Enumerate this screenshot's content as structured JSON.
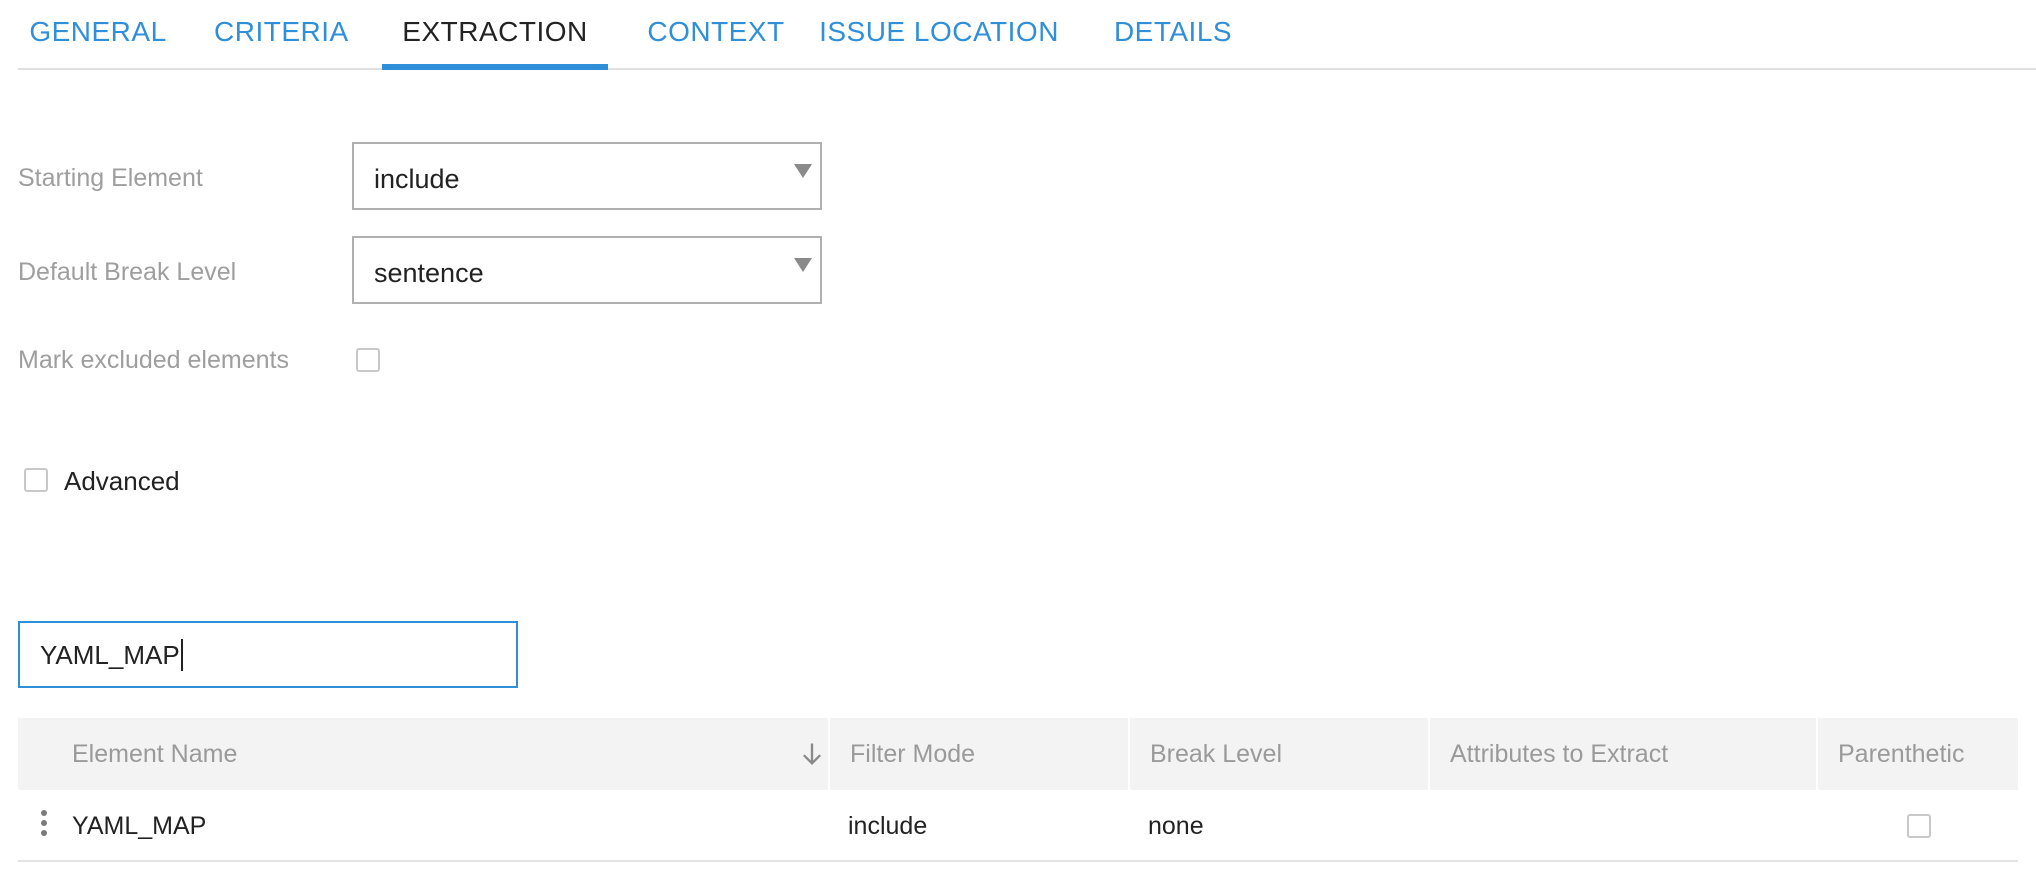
{
  "tabs": [
    {
      "label": "GENERAL",
      "active": false
    },
    {
      "label": "CRITERIA",
      "active": false
    },
    {
      "label": "EXTRACTION",
      "active": true
    },
    {
      "label": "CONTEXT",
      "active": false
    },
    {
      "label": "ISSUE LOCATION",
      "active": false
    },
    {
      "label": "DETAILS",
      "active": false
    }
  ],
  "form": {
    "starting_element": {
      "label": "Starting Element",
      "value": "include"
    },
    "default_break_level": {
      "label": "Default Break Level",
      "value": "sentence"
    },
    "mark_excluded": {
      "label": "Mark excluded elements",
      "checked": false
    },
    "advanced": {
      "label": "Advanced",
      "checked": false
    }
  },
  "search": {
    "value": "YAML_MAP"
  },
  "table": {
    "columns": [
      "Element Name",
      "Filter Mode",
      "Break Level",
      "Attributes to Extract",
      "Parenthetic"
    ],
    "sort": {
      "column": "Element Name",
      "direction": "descending"
    },
    "rows": [
      {
        "element_name": "YAML_MAP",
        "filter_mode": "include",
        "break_level": "none",
        "attributes": "",
        "parenthetic": false
      }
    ]
  },
  "colors": {
    "accent": "#2f8fd9",
    "label_gray": "#9e9e9e",
    "header_bg": "#f3f3f3"
  },
  "icons": {
    "sort": "arrow-down-icon",
    "row_menu": "more-vertical-icon",
    "select_caret": "caret-down-icon"
  }
}
